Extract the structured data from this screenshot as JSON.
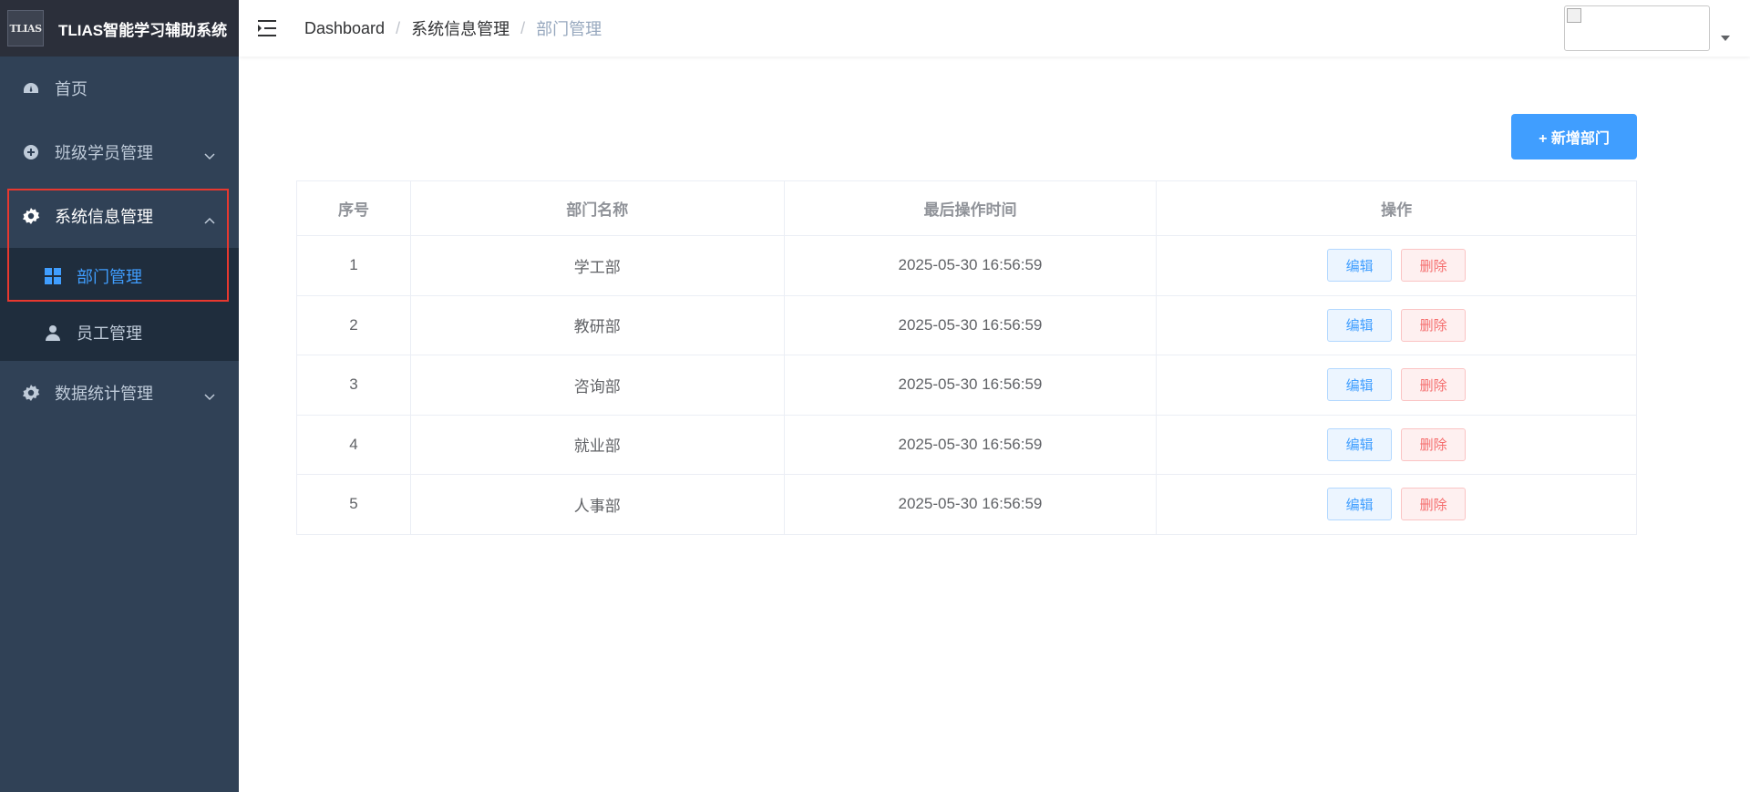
{
  "app": {
    "logo_text": "TLIAS",
    "title": "TLIAS智能学习辅助系统"
  },
  "sidebar": {
    "items": [
      {
        "label": "首页",
        "icon": "dashboard-icon"
      },
      {
        "label": "班级学员管理",
        "icon": "circle-plus-icon",
        "expanded": false
      },
      {
        "label": "系统信息管理",
        "icon": "gear-icon",
        "expanded": true,
        "children": [
          {
            "label": "部门管理",
            "icon": "grid-icon",
            "active": true
          },
          {
            "label": "员工管理",
            "icon": "user-icon"
          }
        ]
      },
      {
        "label": "数据统计管理",
        "icon": "gear-icon",
        "expanded": false
      }
    ]
  },
  "breadcrumb": [
    "Dashboard",
    "系统信息管理",
    "部门管理"
  ],
  "toolbar": {
    "add_label": "+ 新增部门"
  },
  "table": {
    "columns": [
      "序号",
      "部门名称",
      "最后操作时间",
      "操作"
    ],
    "rows": [
      {
        "idx": "1",
        "name": "学工部",
        "time": "2025-05-30 16:56:59"
      },
      {
        "idx": "2",
        "name": "教研部",
        "time": "2025-05-30 16:56:59"
      },
      {
        "idx": "3",
        "name": "咨询部",
        "time": "2025-05-30 16:56:59"
      },
      {
        "idx": "4",
        "name": "就业部",
        "time": "2025-05-30 16:56:59"
      },
      {
        "idx": "5",
        "name": "人事部",
        "time": "2025-05-30 16:56:59"
      }
    ],
    "edit_label": "编辑",
    "delete_label": "删除"
  },
  "colors": {
    "sidebar_bg": "#304156",
    "submenu_bg": "#1f2d3d",
    "primary": "#409eff",
    "danger": "#f56c6c",
    "highlight": "#e8382f"
  }
}
